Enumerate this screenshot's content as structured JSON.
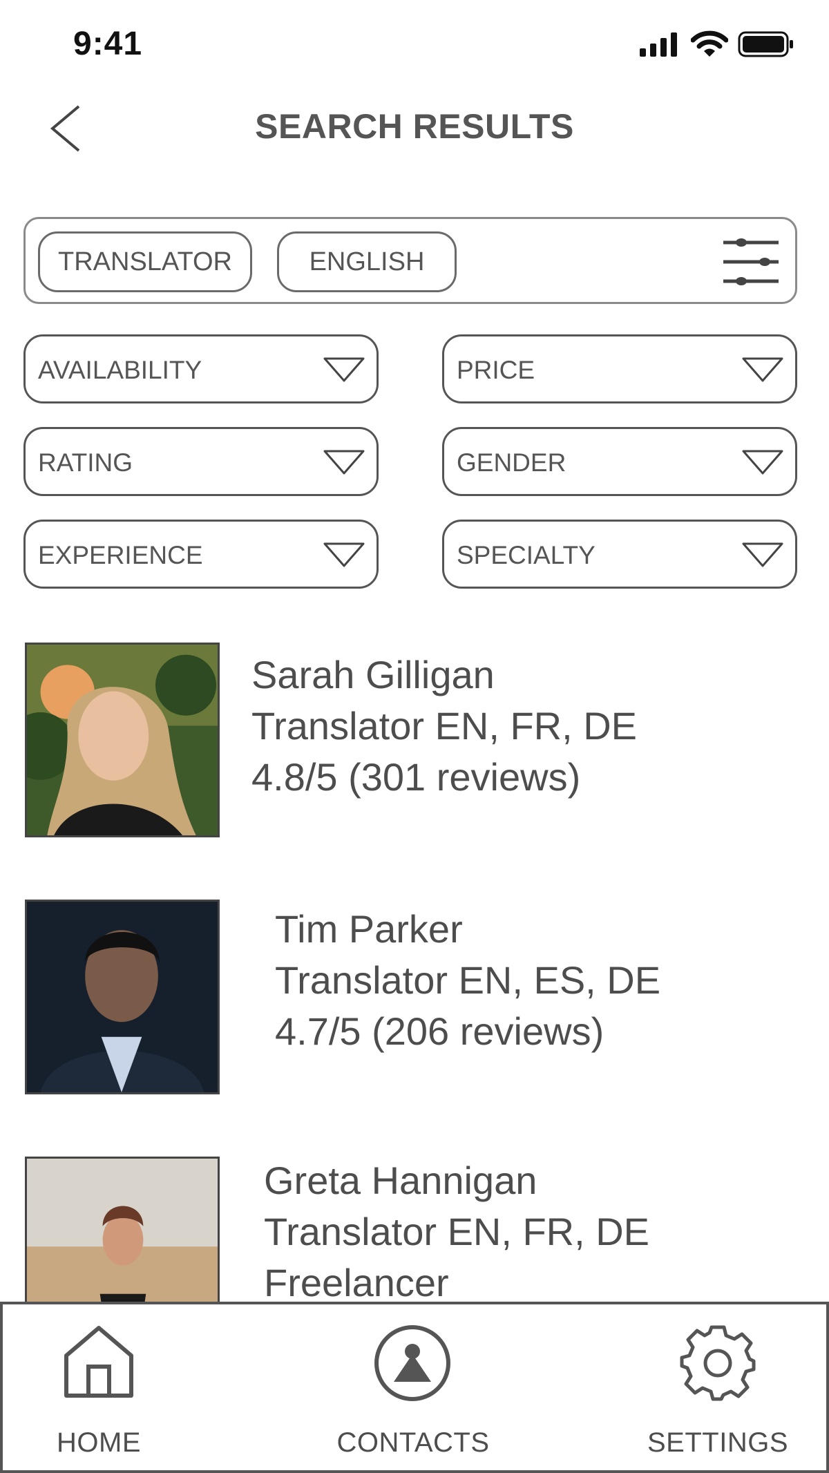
{
  "status_bar": {
    "time": "9:41"
  },
  "header": {
    "title": "SEARCH RESULTS"
  },
  "search": {
    "chips": [
      "TRANSLATOR",
      "ENGLISH"
    ]
  },
  "filters": [
    {
      "label": "AVAILABILITY"
    },
    {
      "label": "PRICE"
    },
    {
      "label": "RATING"
    },
    {
      "label": "GENDER"
    },
    {
      "label": "EXPERIENCE"
    },
    {
      "label": "SPECIALTY"
    }
  ],
  "results": [
    {
      "name": "Sarah Gilligan",
      "role": "Translator EN, FR, DE",
      "detail": "4.8/5 (301 reviews)"
    },
    {
      "name": "Tim Parker",
      "role": "Translator EN, ES, DE",
      "detail": "4.7/5 (206 reviews)"
    },
    {
      "name": "Greta Hannigan",
      "role": "Translator EN, FR, DE",
      "detail": "Freelancer"
    }
  ],
  "bottom_nav": {
    "items": [
      {
        "label": "HOME",
        "icon": "home-icon"
      },
      {
        "label": "CONTACTS",
        "icon": "contact-icon"
      },
      {
        "label": "SETTINGS",
        "icon": "gear-icon"
      }
    ]
  },
  "colors": {
    "text": "#4d4d4d",
    "border": "#555555",
    "background": "#ffffff"
  }
}
